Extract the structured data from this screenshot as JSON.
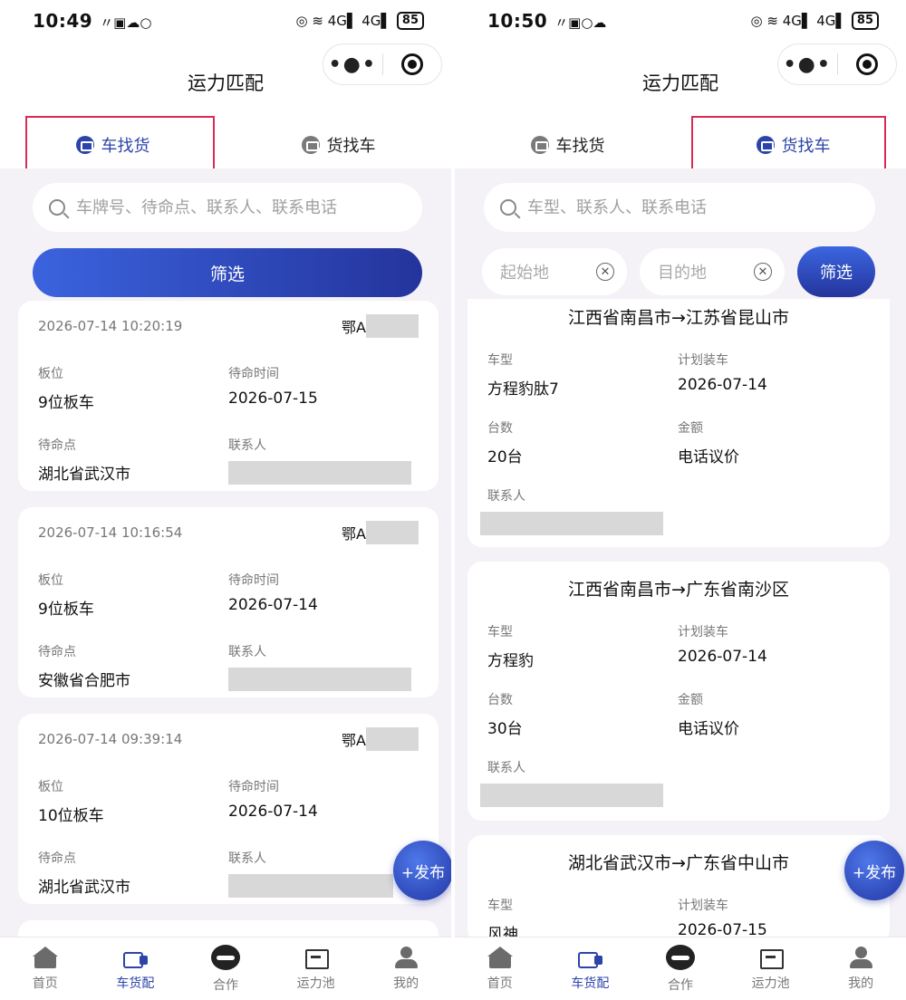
{
  "left": {
    "status": {
      "time": "10:49",
      "battery": "85"
    },
    "title": "运力匹配",
    "tabs": [
      {
        "label": "车找货"
      },
      {
        "label": "货找车"
      }
    ],
    "search_placeholder": "车牌号、待命点、联系人、联系电话",
    "filter_label": "筛选",
    "cards": [
      {
        "time": "2026-07-14 10:20:19",
        "plate": "鄂A",
        "l1": "板位",
        "v1": "9位板车",
        "l2": "待命时间",
        "v2": "2026-07-15",
        "l3": "待命点",
        "v3": "湖北省武汉市",
        "l4": "联系人"
      },
      {
        "time": "2026-07-14 10:16:54",
        "plate": "鄂A",
        "l1": "板位",
        "v1": "9位板车",
        "l2": "待命时间",
        "v2": "2026-07-14",
        "l3": "待命点",
        "v3": "安徽省合肥市",
        "l4": "联系人"
      },
      {
        "time": "2026-07-14 09:39:14",
        "plate": "鄂A",
        "l1": "板位",
        "v1": "10位板车",
        "l2": "待命时间",
        "v2": "2026-07-14",
        "l3": "待命点",
        "v3": "湖北省武汉市",
        "l4": "联系人"
      }
    ],
    "publish": "+发布"
  },
  "right": {
    "status": {
      "time": "10:50",
      "battery": "85"
    },
    "title": "运力匹配",
    "tabs": [
      {
        "label": "车找货"
      },
      {
        "label": "货找车"
      }
    ],
    "search_placeholder": "车型、联系人、联系电话",
    "origin_placeholder": "起始地",
    "dest_placeholder": "目的地",
    "filter_label": "筛选",
    "cards": [
      {
        "route": "江西省南昌市→江苏省昆山市",
        "l1": "车型",
        "v1": "方程豹肽7",
        "l2": "计划装车",
        "v2": "2026-07-14",
        "l3": "台数",
        "v3": "20台",
        "l4": "金额",
        "v4": "电话议价",
        "l5": "联系人"
      },
      {
        "route": "江西省南昌市→广东省南沙区",
        "l1": "车型",
        "v1": "方程豹",
        "l2": "计划装车",
        "v2": "2026-07-14",
        "l3": "台数",
        "v3": "30台",
        "l4": "金额",
        "v4": "电话议价",
        "l5": "联系人"
      },
      {
        "route": "湖北省武汉市→广东省中山市",
        "l1": "车型",
        "v1": "风神",
        "l2": "计划装车",
        "v2": "2026-07-15"
      }
    ],
    "publish": "+发布"
  },
  "nav": [
    {
      "label": "首页",
      "icon": "home-icon"
    },
    {
      "label": "车货配",
      "icon": "truck-icon"
    },
    {
      "label": "合作",
      "icon": "handshake-icon"
    },
    {
      "label": "运力池",
      "icon": "capacity-pool-icon"
    },
    {
      "label": "我的",
      "icon": "profile-icon"
    }
  ],
  "colors": {
    "accent": "#2c44a8",
    "highlight": "#d92b53",
    "background": "#f4f1f7"
  }
}
